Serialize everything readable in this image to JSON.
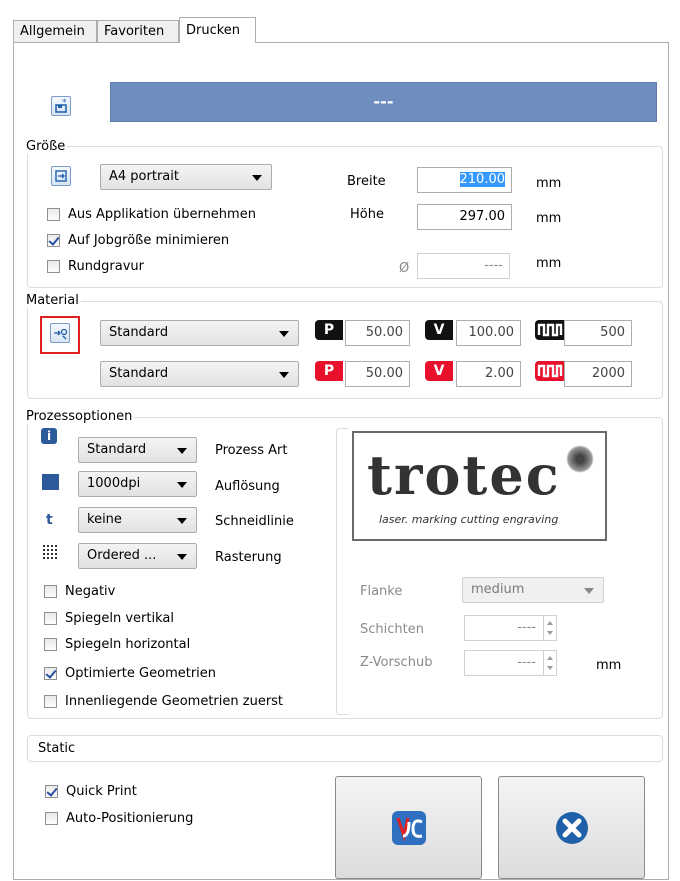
{
  "tabs": [
    "Allgemein",
    "Favoriten",
    "Drucken"
  ],
  "header": {
    "job_name": "---"
  },
  "groesse": {
    "title": "Größe",
    "format_value": "A4 portrait",
    "breite_label": "Breite",
    "breite_value": "210.00",
    "hoehe_label": "Höhe",
    "hoehe_value": "297.00",
    "unit": "mm",
    "diameter_symbol": "Ø",
    "diameter_value": "----",
    "cb_aus_applikation": "Aus Applikation übernehmen",
    "cb_auf_jobgroesse": "Auf Jobgröße minimieren",
    "cb_rundgravur": "Rundgravur"
  },
  "material": {
    "title": "Material",
    "row1": {
      "select": "Standard",
      "p_label": "P",
      "p_value": "50.00",
      "v_label": "V",
      "v_value": "100.00",
      "ppi_value": "500"
    },
    "row2": {
      "select": "Standard",
      "p_label": "P",
      "p_value": "50.00",
      "v_label": "V",
      "v_value": "2.00",
      "ppi_value": "2000"
    }
  },
  "prozess": {
    "title": "Prozessoptionen",
    "rows": [
      {
        "value": "Standard",
        "label": "Prozess Art"
      },
      {
        "value": "1000dpi",
        "label": "Auflösung"
      },
      {
        "value": "keine",
        "label": "Schneidlinie"
      },
      {
        "value": "Ordered ...",
        "label": "Rasterung"
      }
    ],
    "cut_icon": "t",
    "checkboxes": [
      "Negativ",
      "Spiegeln vertikal",
      "Spiegeln horizontal",
      "Optimierte Geometrien",
      "Innenliegende Geometrien zuerst"
    ],
    "logo": {
      "word": "trotec",
      "tagline": "laser. marking cutting engraving"
    },
    "flanke_label": "Flanke",
    "flanke_value": "medium",
    "schichten_label": "Schichten",
    "schichten_value": "----",
    "zvorschub_label": "Z-Vorschub",
    "zvorschub_value": "----",
    "zvorschub_unit": "mm"
  },
  "static": {
    "label": "Static"
  },
  "footer": {
    "quick_print": "Quick Print",
    "auto_position": "Auto-Positionierung"
  },
  "colors": {
    "header_bar": "#6f8ec0",
    "badge_black": "#111111",
    "badge_red": "#e8102a",
    "highlight": "#e02020"
  }
}
